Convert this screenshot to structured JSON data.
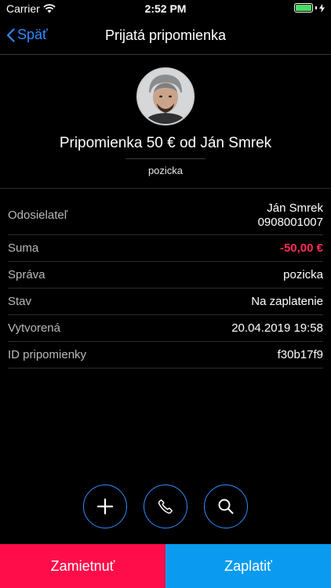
{
  "status_bar": {
    "carrier": "Carrier",
    "time": "2:52 PM",
    "battery_level": 1.0,
    "battery_color": "#4cd964"
  },
  "nav": {
    "back_label": "Späť",
    "title": "Prijatá pripomienka",
    "accent_color": "#2f8bff"
  },
  "header": {
    "avatar_icon": "person-photo",
    "headline": "Pripomienka 50 € od Ján Smrek",
    "note": "pozicka"
  },
  "details": [
    {
      "label": "Odosielateľ",
      "value": "Ján Smrek",
      "value2": "0908001007"
    },
    {
      "label": "Suma",
      "value": "-50,00 €",
      "color": "#ff2d55"
    },
    {
      "label": "Správa",
      "value": "pozicka"
    },
    {
      "label": "Stav",
      "value": "Na zaplatenie"
    },
    {
      "label": "Vytvorená",
      "value": "20.04.2019 19:58"
    },
    {
      "label": "ID pripomienky",
      "value": "f30b17f9"
    }
  ],
  "actions": [
    {
      "icon": "plus-icon"
    },
    {
      "icon": "phone-icon"
    },
    {
      "icon": "search-icon"
    }
  ],
  "buttons": {
    "reject_label": "Zamietnuť",
    "pay_label": "Zaplatiť",
    "reject_color": "#ff0d4a",
    "pay_color": "#0a9bf0"
  }
}
